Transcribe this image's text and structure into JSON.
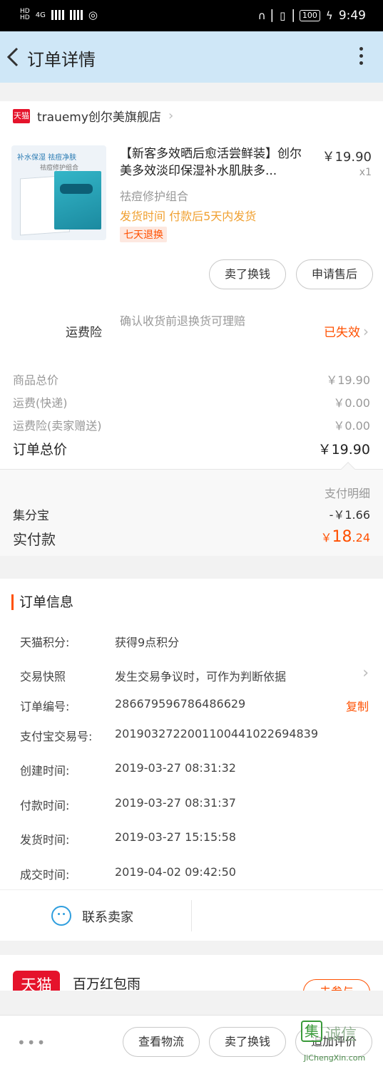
{
  "statusbar": {
    "left": "4G",
    "battery": "100",
    "time": "9:49"
  },
  "nav": {
    "title": "订单详情"
  },
  "shop": {
    "badge": "天猫",
    "name": "trauemy创尔美旗舰店"
  },
  "product": {
    "thumb_line1": "补水保湿  祛痘净肤",
    "thumb_line2": "祛痘修护组合",
    "title": "【新客多效晒后愈活尝鲜装】创尔美多效淡印保湿补水肌肤多...",
    "price": "￥19.90",
    "qty": "x1",
    "sku": "祛痘修护组合",
    "ship_time": "发货时间 付款后5天内发货",
    "tag": "七天退换",
    "btn_sell": "卖了换钱",
    "btn_after": "申请售后"
  },
  "insurance": {
    "label": "运费险",
    "desc": "确认收货前退换货可理赔",
    "status": "已失效"
  },
  "summary": {
    "goods_label": "商品总价",
    "goods_value": "￥19.90",
    "freight_label": "运费(快递)",
    "freight_value": "￥0.00",
    "ins_label": "运费险(卖家赠送)",
    "ins_value": "￥0.00",
    "total_label": "订单总价",
    "total_value": "￥19.90"
  },
  "payment": {
    "detail": "支付明细",
    "jifen_label": "集分宝",
    "jifen_value": "-￥1.66",
    "paid_label": "实付款",
    "paid_currency": "￥",
    "paid_int": "18",
    "paid_dec": ".24"
  },
  "info": {
    "title": "订单信息",
    "rows": [
      {
        "k": "天猫积分:",
        "v": "获得9点积分"
      },
      {
        "k": "交易快照",
        "v": "发生交易争议时，可作为判断依据"
      },
      {
        "k": "订单编号:",
        "v": "286679596786486629",
        "action": "复制"
      },
      {
        "k": "支付宝交易号:",
        "v": "2019032722001100441022694839"
      },
      {
        "k": "创建时间:",
        "v": "2019-03-27 08:31:32"
      },
      {
        "k": "付款时间:",
        "v": "2019-03-27 08:31:37"
      },
      {
        "k": "发货时间:",
        "v": "2019-03-27 15:15:58"
      },
      {
        "k": "成交时间:",
        "v": "2019-04-02 09:42:50"
      }
    ]
  },
  "contact": {
    "label": "联系卖家"
  },
  "promo": {
    "logo": "天猫",
    "text": "百万红包雨",
    "button": "去参与"
  },
  "bottom": {
    "dots": "•••",
    "logistics": "查看物流",
    "sell": "卖了换钱",
    "review": "追加评价"
  },
  "watermark": {
    "logo": "集",
    "text": "诚信",
    "url": "JiChengXin.com"
  }
}
